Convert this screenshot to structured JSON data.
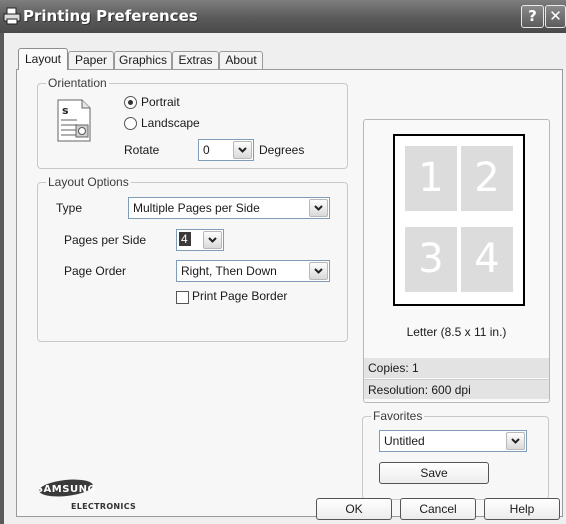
{
  "window": {
    "title": "Printing Preferences",
    "help_glyph": "?",
    "close_glyph": "✕"
  },
  "tabs": [
    {
      "label": "Layout",
      "active": true
    },
    {
      "label": "Paper",
      "active": false
    },
    {
      "label": "Graphics",
      "active": false
    },
    {
      "label": "Extras",
      "active": false
    },
    {
      "label": "About",
      "active": false
    }
  ],
  "orientation": {
    "group_label": "Orientation",
    "portrait_label": "Portrait",
    "landscape_label": "Landscape",
    "selected": "Portrait",
    "rotate_label": "Rotate",
    "rotate_value": "0",
    "degrees_label": "Degrees"
  },
  "layout_options": {
    "group_label": "Layout Options",
    "type_label": "Type",
    "type_value": "Multiple Pages per Side",
    "pages_per_side_label": "Pages per Side",
    "pages_per_side_value": "4",
    "page_order_label": "Page Order",
    "page_order_value": "Right, Then Down",
    "print_border_label": "Print Page Border",
    "print_border_checked": false
  },
  "preview": {
    "page_numbers": [
      "1",
      "2",
      "3",
      "4"
    ],
    "paper_size": "Letter (8.5 x 11 in.)",
    "copies": "Copies: 1",
    "resolution": "Resolution: 600 dpi"
  },
  "favorites": {
    "group_label": "Favorites",
    "value": "Untitled",
    "save_label": "Save"
  },
  "logo": {
    "brand": "SAMSUNG",
    "sub": "ELECTRONICS"
  },
  "footer": {
    "ok_label": "OK",
    "cancel_label": "Cancel",
    "help_label": "Help"
  },
  "colors": {
    "titlebar": "#5a5a5a",
    "dialog_bg": "#efefef",
    "page_cell": "#dcdcdc"
  }
}
